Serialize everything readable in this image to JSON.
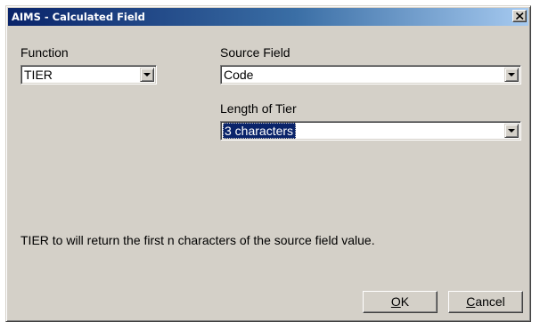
{
  "window": {
    "title": "AIMS - Calculated Field",
    "close_symbol": "close-icon"
  },
  "function": {
    "label": "Function",
    "value": "TIER"
  },
  "source_field": {
    "label": "Source Field",
    "value": "Code"
  },
  "length_of_tier": {
    "label": "Length of Tier",
    "value": "3 characters"
  },
  "description": "TIER to will return the first n characters of the source field value.",
  "buttons": {
    "ok": {
      "mnemonic": "O",
      "rest": "K"
    },
    "cancel": {
      "mnemonic": "C",
      "rest": "ancel"
    }
  },
  "colors": {
    "title_gradient_start": "#0a246a",
    "title_gradient_end": "#a6caf0",
    "face": "#d4d0c8",
    "selection": "#0a246a"
  }
}
